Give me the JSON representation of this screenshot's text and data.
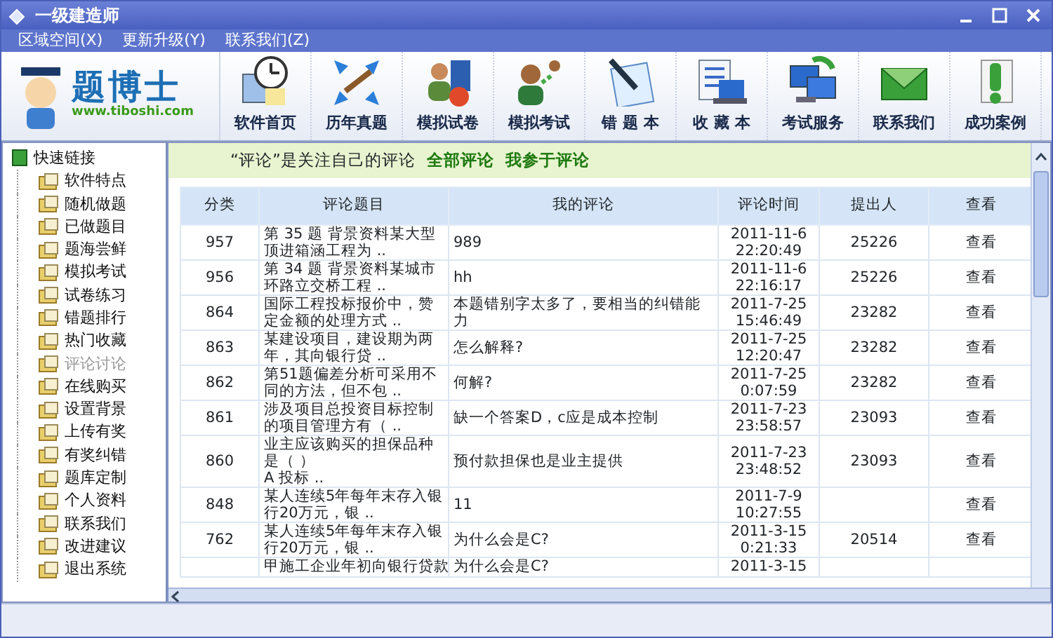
{
  "window": {
    "title": "一级建造师"
  },
  "menu": [
    "区域空间(X)",
    "更新升级(Y)",
    "联系我们(Z)"
  ],
  "logo": {
    "name": "题博士",
    "url": "www.tiboshi.com"
  },
  "toolbar": [
    "软件首页",
    "历年真题",
    "模拟试卷",
    "模拟考试",
    "错 题 本",
    "收 藏 本",
    "考试服务",
    "联系我们",
    "成功案例"
  ],
  "sidebar": {
    "root": "快速链接",
    "children": [
      {
        "label": "软件特点",
        "selected": false
      },
      {
        "label": "随机做题",
        "selected": false
      },
      {
        "label": "已做题目",
        "selected": false
      },
      {
        "label": "题海尝鲜",
        "selected": false
      },
      {
        "label": "模拟考试",
        "selected": false
      },
      {
        "label": "试卷练习",
        "selected": false
      },
      {
        "label": "错题排行",
        "selected": false
      },
      {
        "label": "热门收藏",
        "selected": false
      },
      {
        "label": "评论讨论",
        "selected": true
      },
      {
        "label": "在线购买",
        "selected": false
      },
      {
        "label": "设置背景",
        "selected": false
      },
      {
        "label": "上传有奖",
        "selected": false
      },
      {
        "label": "有奖纠错",
        "selected": false
      },
      {
        "label": "题库定制",
        "selected": false
      },
      {
        "label": "个人资料",
        "selected": false
      },
      {
        "label": "联系我们",
        "selected": false
      },
      {
        "label": "改进建议",
        "selected": false
      },
      {
        "label": "退出系统",
        "selected": false
      }
    ]
  },
  "notice": {
    "text": "“评论”是关注自己的评论",
    "links": [
      "全部评论",
      "我参于评论"
    ]
  },
  "table": {
    "columns": [
      "分类",
      "评论题目",
      "我的评论",
      "评论时间",
      "提出人",
      "查看"
    ],
    "rows": [
      [
        "957",
        "第 35 题 背景资料某大型顶进箱涵工程为 ..",
        "989",
        "2011-11-6 22:20:49",
        "25226",
        "查看"
      ],
      [
        "956",
        "第 34 题 背景资料某城市环路立交桥工程 ..",
        "hh",
        "2011-11-6 22:16:17",
        "25226",
        "查看"
      ],
      [
        "864",
        "国际工程投标报价中，赞定金额的处理方式 ..",
        "本题错别字太多了，要相当的纠错能力",
        "2011-7-25 15:46:49",
        "23282",
        "查看"
      ],
      [
        "863",
        "某建设项目，建设期为两年，其向银行贷 ..",
        "怎么解释?",
        "2011-7-25 12:20:47",
        "23282",
        "查看"
      ],
      [
        "862",
        "第51题偏差分析可采用不同的方法，但不包 ..",
        "何解?",
        "2011-7-25 0:07:59",
        "23282",
        "查看"
      ],
      [
        "861",
        "涉及项目总投资目标控制的项目管理方有（ ..",
        "缺一个答案D，c应是成本控制",
        "2011-7-23 23:58:57",
        "23093",
        "查看"
      ],
      [
        "860",
        "业主应该购买的担保品种是（ ）\nA 投标 ..",
        "预付款担保也是业主提供",
        "2011-7-23 23:48:52",
        "23093",
        "查看"
      ],
      [
        "848",
        "某人连续5年每年末存入银行20万元，银 ..",
        "11",
        "2011-7-9 10:27:55",
        "",
        "查看"
      ],
      [
        "762",
        "某人连续5年每年末存入银行20万元，银 ..",
        "为什么会是C?",
        "2011-3-15 0:21:33",
        "20514",
        "查看"
      ],
      [
        "",
        "甲施工企业年初向银行贷款",
        "为什么会是C?",
        "2011-3-15",
        "",
        ""
      ]
    ]
  }
}
